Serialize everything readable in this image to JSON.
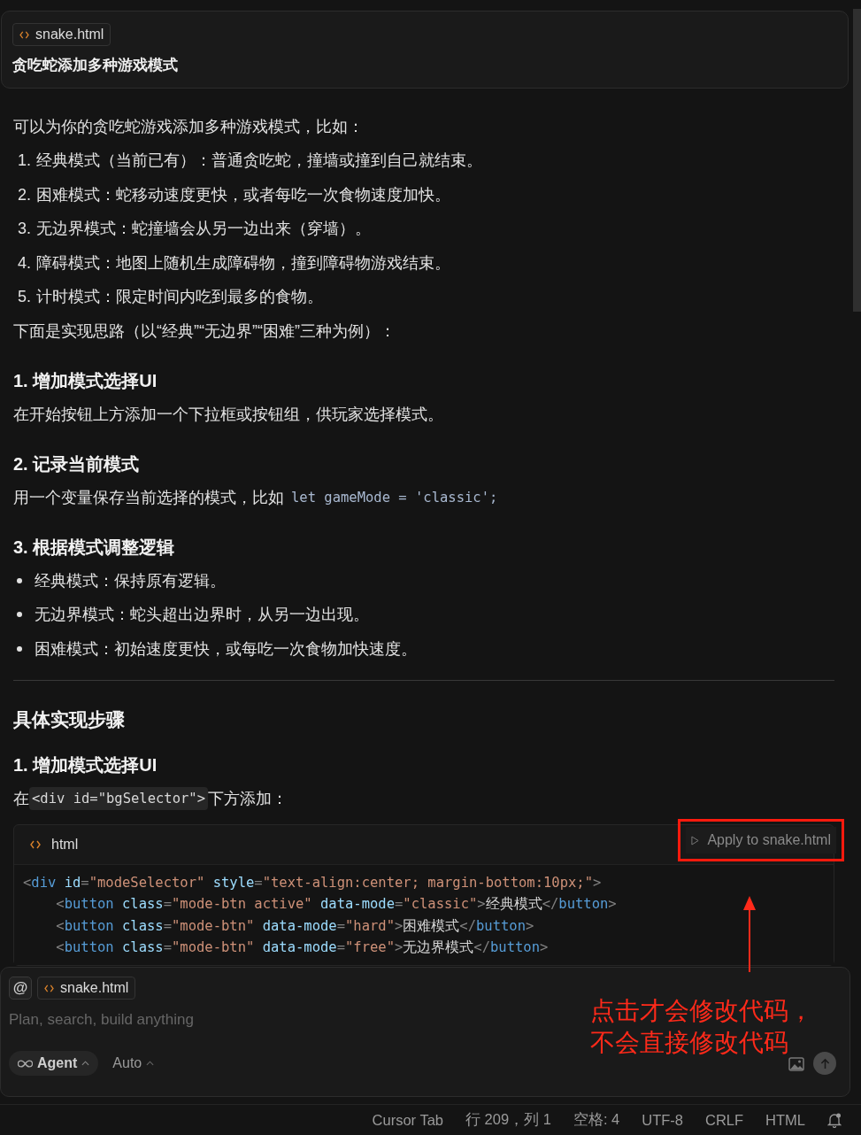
{
  "prompt_card": {
    "file_chip": "snake.html",
    "message": "贪吃蛇添加多种游戏模式"
  },
  "response": {
    "intro": "可以为你的贪吃蛇游戏添加多种游戏模式，比如：",
    "modes": [
      {
        "number": "1.",
        "text": "经典模式（当前已有）：普通贪吃蛇，撞墙或撞到自己就结束。"
      },
      {
        "number": "2.",
        "text": "困难模式：蛇移动速度更快，或者每吃一次食物速度加快。"
      },
      {
        "number": "3.",
        "text": "无边界模式：蛇撞墙会从另一边出来（穿墙）。"
      },
      {
        "number": "4.",
        "text": "障碍模式：地图上随机生成障碍物，撞到障碍物游戏结束。"
      },
      {
        "number": "5.",
        "text": "计时模式：限定时间内吃到最多的食物。"
      }
    ],
    "approach": "下面是实现思路（以“经典”“无边界”“困难”三种为例）：",
    "steps": [
      {
        "heading": "1. 增加模式选择UI",
        "text": "在开始按钮上方添加一个下拉框或按钮组，供玩家选择模式。"
      },
      {
        "heading": "2. 记录当前模式",
        "text": "用一个变量保存当前选择的模式，比如",
        "code": "let gameMode = 'classic';"
      },
      {
        "heading": "3. 根据模式调整逻辑",
        "bullets": [
          "经典模式：保持原有逻辑。",
          "无边界模式：蛇头超出边界时，从另一边出现。",
          "困难模式：初始速度更快，或每吃一次食物加快速度。"
        ]
      }
    ],
    "section_heading": "具体实现步骤",
    "sub_heading": "1. 增加模式选择UI",
    "instruction": [
      {
        "kind": "text",
        "t": "在"
      },
      {
        "kind": "code",
        "t": "<div id=\"bgSelector\">"
      },
      {
        "kind": "text",
        "t": "下方添加："
      }
    ],
    "code_block": {
      "language": "html",
      "apply_button": "Apply to snake.html",
      "lines": [
        [
          {
            "kind": "p",
            "t": "<"
          },
          {
            "kind": "tag",
            "t": "div"
          },
          {
            "kind": "attr",
            "t": " id"
          },
          {
            "kind": "p",
            "t": "="
          },
          {
            "kind": "str",
            "t": "\"modeSelector\""
          },
          {
            "kind": "attr",
            "t": " style"
          },
          {
            "kind": "p",
            "t": "="
          },
          {
            "kind": "str",
            "t": "\"text-align:center; margin-bottom:10px;\""
          },
          {
            "kind": "p",
            "t": ">"
          }
        ],
        [
          {
            "kind": "p",
            "t": "    <"
          },
          {
            "kind": "tag",
            "t": "button"
          },
          {
            "kind": "attr",
            "t": " class"
          },
          {
            "kind": "p",
            "t": "="
          },
          {
            "kind": "str",
            "t": "\"mode-btn active\""
          },
          {
            "kind": "attr",
            "t": " data-mode"
          },
          {
            "kind": "p",
            "t": "="
          },
          {
            "kind": "str",
            "t": "\"classic\""
          },
          {
            "kind": "p",
            "t": ">"
          },
          {
            "kind": "text",
            "t": "经典模式"
          },
          {
            "kind": "p",
            "t": "</"
          },
          {
            "kind": "tag",
            "t": "button"
          },
          {
            "kind": "p",
            "t": ">"
          }
        ],
        [
          {
            "kind": "p",
            "t": "    <"
          },
          {
            "kind": "tag",
            "t": "button"
          },
          {
            "kind": "attr",
            "t": " class"
          },
          {
            "kind": "p",
            "t": "="
          },
          {
            "kind": "str",
            "t": "\"mode-btn\""
          },
          {
            "kind": "attr",
            "t": " data-mode"
          },
          {
            "kind": "p",
            "t": "="
          },
          {
            "kind": "str",
            "t": "\"hard\""
          },
          {
            "kind": "p",
            "t": ">"
          },
          {
            "kind": "text",
            "t": "困难模式"
          },
          {
            "kind": "p",
            "t": "</"
          },
          {
            "kind": "tag",
            "t": "button"
          },
          {
            "kind": "p",
            "t": ">"
          }
        ],
        [
          {
            "kind": "p",
            "t": "    <"
          },
          {
            "kind": "tag",
            "t": "button"
          },
          {
            "kind": "attr",
            "t": " class"
          },
          {
            "kind": "p",
            "t": "="
          },
          {
            "kind": "str",
            "t": "\"mode-btn\""
          },
          {
            "kind": "attr",
            "t": " data-mode"
          },
          {
            "kind": "p",
            "t": "="
          },
          {
            "kind": "str",
            "t": "\"free\""
          },
          {
            "kind": "p",
            "t": ">"
          },
          {
            "kind": "text",
            "t": "无边界模式"
          },
          {
            "kind": "p",
            "t": "</"
          },
          {
            "kind": "tag",
            "t": "button"
          },
          {
            "kind": "p",
            "t": ">"
          }
        ]
      ]
    }
  },
  "composer": {
    "mention_button": "@",
    "file_chip": "snake.html",
    "placeholder": "Plan, search, build anything",
    "mode_button": "Agent",
    "model_button": "Auto"
  },
  "annotation": {
    "lines": [
      "点击才会修改代码，",
      "不会直接修改代码"
    ]
  },
  "status_bar": [
    "Cursor Tab",
    "行 209，列 1",
    "空格: 4",
    "UTF-8",
    "CRLF",
    "HTML"
  ]
}
